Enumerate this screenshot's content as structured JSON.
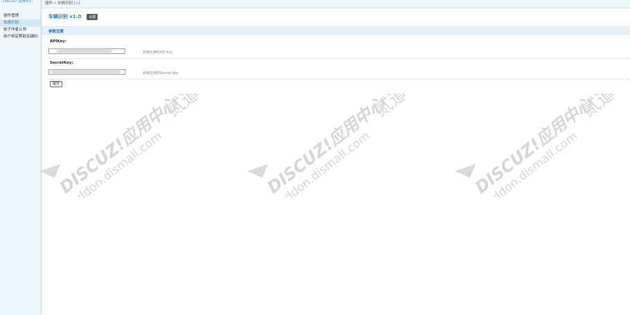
{
  "sidebar": {
    "brand": "DISCUZ! 应用中心",
    "items": [
      {
        "label": "插件管理",
        "active": false
      },
      {
        "label": "车辆识别",
        "active": true
      },
      {
        "label": "帖子作者认领",
        "active": false
      },
      {
        "label": "用户绑定帮助关键码",
        "active": false
      }
    ]
  },
  "breadcrumb": {
    "path": "插件 » 车辆识别",
    "add": "[+]"
  },
  "header": {
    "title": "车辆识别 v1.0",
    "settings_label": "设置"
  },
  "section": {
    "title": "参数设置"
  },
  "fields": {
    "api_key": {
      "label": "APIKey:",
      "hint": "百度应用的API Key",
      "value": ""
    },
    "secret_key": {
      "label": "SecretKey:",
      "hint": "百度应用的Secret Key",
      "value": ""
    }
  },
  "submit_label": "提交",
  "watermark": {
    "line1": "DISCUZ!应用中心",
    "line2": "addon.dismall.com",
    "brand": "贰道"
  },
  "colors": {
    "accent": "#2b7bbf",
    "sidebar_bg": "#eef5fb",
    "section_bg": "#e7f1fa"
  }
}
